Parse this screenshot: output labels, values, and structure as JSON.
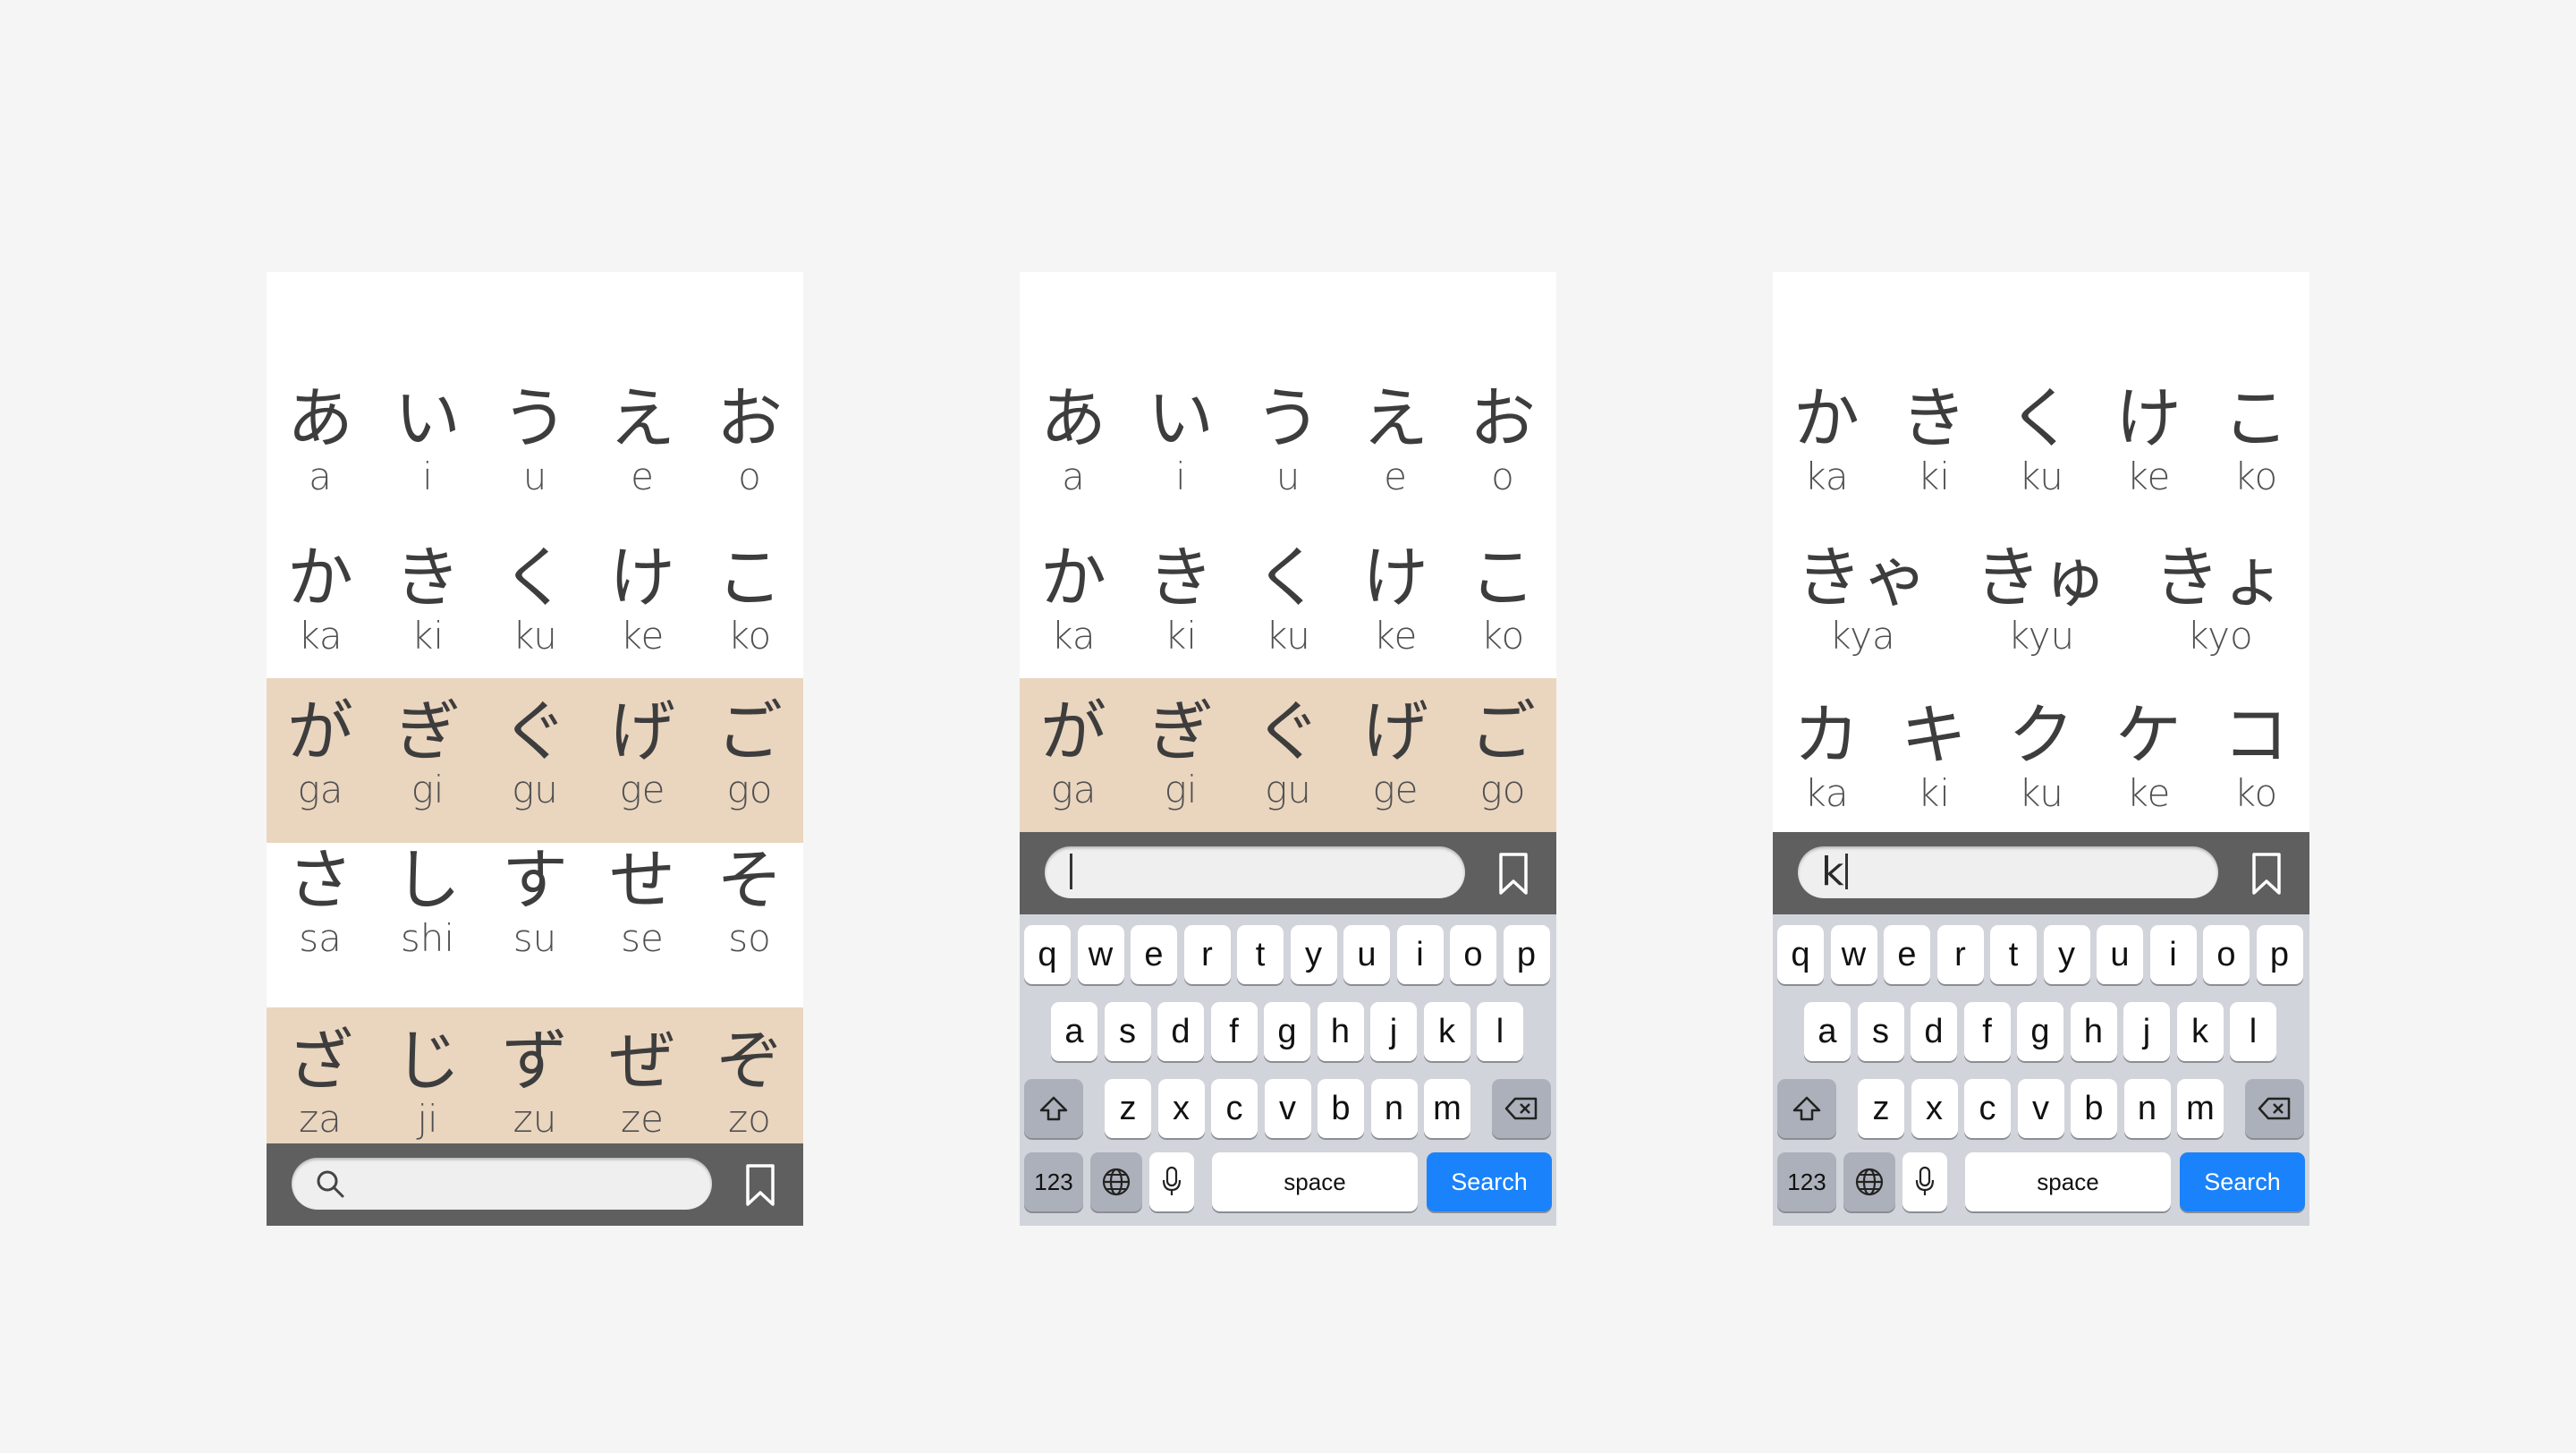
{
  "screens": [
    {
      "rows": [
        {
          "tint": false,
          "cells": [
            {
              "kana": "あ",
              "romaji": "a"
            },
            {
              "kana": "い",
              "romaji": "i"
            },
            {
              "kana": "う",
              "romaji": "u"
            },
            {
              "kana": "え",
              "romaji": "e"
            },
            {
              "kana": "お",
              "romaji": "o"
            }
          ]
        },
        {
          "tint": false,
          "cells": [
            {
              "kana": "か",
              "romaji": "ka"
            },
            {
              "kana": "き",
              "romaji": "ki"
            },
            {
              "kana": "く",
              "romaji": "ku"
            },
            {
              "kana": "け",
              "romaji": "ke"
            },
            {
              "kana": "こ",
              "romaji": "ko"
            }
          ]
        },
        {
          "tint": true,
          "cells": [
            {
              "kana": "が",
              "romaji": "ga"
            },
            {
              "kana": "ぎ",
              "romaji": "gi"
            },
            {
              "kana": "ぐ",
              "romaji": "gu"
            },
            {
              "kana": "げ",
              "romaji": "ge"
            },
            {
              "kana": "ご",
              "romaji": "go"
            }
          ]
        },
        {
          "tint": false,
          "cells": [
            {
              "kana": "さ",
              "romaji": "sa"
            },
            {
              "kana": "し",
              "romaji": "shi"
            },
            {
              "kana": "す",
              "romaji": "su"
            },
            {
              "kana": "せ",
              "romaji": "se"
            },
            {
              "kana": "そ",
              "romaji": "so"
            }
          ]
        },
        {
          "tint": true,
          "cells": [
            {
              "kana": "ざ",
              "romaji": "za"
            },
            {
              "kana": "じ",
              "romaji": "ji"
            },
            {
              "kana": "ず",
              "romaji": "zu"
            },
            {
              "kana": "ぜ",
              "romaji": "ze"
            },
            {
              "kana": "ぞ",
              "romaji": "zo"
            }
          ]
        }
      ],
      "search": {
        "value": "",
        "icon": "search-icon"
      },
      "bookmark_icon": "bookmark-icon",
      "keyboard": false
    },
    {
      "rows": [
        {
          "tint": false,
          "cells": [
            {
              "kana": "あ",
              "romaji": "a"
            },
            {
              "kana": "い",
              "romaji": "i"
            },
            {
              "kana": "う",
              "romaji": "u"
            },
            {
              "kana": "え",
              "romaji": "e"
            },
            {
              "kana": "お",
              "romaji": "o"
            }
          ]
        },
        {
          "tint": false,
          "cells": [
            {
              "kana": "か",
              "romaji": "ka"
            },
            {
              "kana": "き",
              "romaji": "ki"
            },
            {
              "kana": "く",
              "romaji": "ku"
            },
            {
              "kana": "け",
              "romaji": "ke"
            },
            {
              "kana": "こ",
              "romaji": "ko"
            }
          ]
        },
        {
          "tint": true,
          "cells": [
            {
              "kana": "が",
              "romaji": "ga"
            },
            {
              "kana": "ぎ",
              "romaji": "gi"
            },
            {
              "kana": "ぐ",
              "romaji": "gu"
            },
            {
              "kana": "げ",
              "romaji": "ge"
            },
            {
              "kana": "ご",
              "romaji": "go"
            }
          ]
        }
      ],
      "search": {
        "value": ""
      },
      "bookmark_icon": "bookmark-icon",
      "keyboard": true
    },
    {
      "rows": [
        {
          "tint": false,
          "cells": [
            {
              "kana": "か",
              "romaji": "ka"
            },
            {
              "kana": "き",
              "romaji": "ki"
            },
            {
              "kana": "く",
              "romaji": "ku"
            },
            {
              "kana": "け",
              "romaji": "ke"
            },
            {
              "kana": "こ",
              "romaji": "ko"
            }
          ]
        },
        {
          "tint": false,
          "cells": [
            {
              "kana": "きゃ",
              "romaji": "kya"
            },
            {
              "kana": "きゅ",
              "romaji": "kyu"
            },
            {
              "kana": "きょ",
              "romaji": "kyo"
            }
          ]
        },
        {
          "tint": false,
          "cells": [
            {
              "kana": "カ",
              "romaji": "ka"
            },
            {
              "kana": "キ",
              "romaji": "ki"
            },
            {
              "kana": "ク",
              "romaji": "ku"
            },
            {
              "kana": "ケ",
              "romaji": "ke"
            },
            {
              "kana": "コ",
              "romaji": "ko"
            }
          ]
        }
      ],
      "search": {
        "value": "k"
      },
      "bookmark_icon": "bookmark-icon",
      "keyboard": true
    }
  ],
  "keyboard": {
    "row1": [
      "q",
      "w",
      "e",
      "r",
      "t",
      "y",
      "u",
      "i",
      "o",
      "p"
    ],
    "row2": [
      "a",
      "s",
      "d",
      "f",
      "g",
      "h",
      "j",
      "k",
      "l"
    ],
    "row3": [
      "z",
      "x",
      "c",
      "v",
      "b",
      "n",
      "m"
    ],
    "shift_icon": "shift-icon",
    "delete_icon": "delete-icon",
    "numbers_label": "123",
    "globe_icon": "globe-icon",
    "mic_icon": "microphone-icon",
    "space_label": "space",
    "search_label": "Search"
  },
  "colors": {
    "background": "#f5f5f5",
    "screen": "#ffffff",
    "row_tint": "#ead5bf",
    "search_bar": "#5f5f5f",
    "keyboard": "#d1d4da",
    "search_key": "#1a82fb"
  }
}
